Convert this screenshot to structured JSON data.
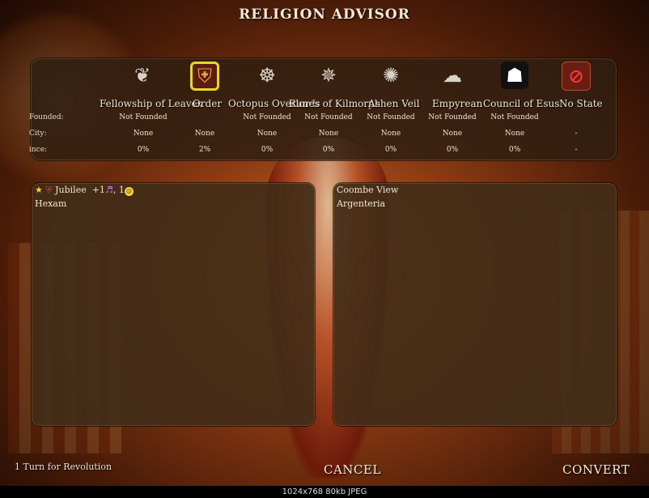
{
  "title": "RELIGION ADVISOR",
  "row_labels": {
    "founded": "Founded:",
    "city": "City:",
    "influence": "ince:"
  },
  "religions": [
    {
      "name": "Fellowship of Leaves",
      "icon": "leaf-icon",
      "founded": "Not Founded",
      "city": "",
      "influence": "0%"
    },
    {
      "name": "Order",
      "icon": "order-shield-icon",
      "founded": "",
      "city": "None",
      "influence": "2%",
      "selected": true
    },
    {
      "name": "Octopus Overlords",
      "icon": "octopus-icon",
      "founded": "Not Founded",
      "city": "None",
      "influence": "0%"
    },
    {
      "name": "Runes of Kilmorph",
      "icon": "rune-compass-icon",
      "founded": "Not Founded",
      "city": "None",
      "influence": "0%"
    },
    {
      "name": "Ashen Veil",
      "icon": "ashen-veil-icon",
      "founded": "Not Founded",
      "city": "None",
      "influence": "0%"
    },
    {
      "name": "Empyrean",
      "icon": "empyrean-wing-icon",
      "founded": "Not Founded",
      "city": "None",
      "influence": "0%"
    },
    {
      "name": "Council of Esus",
      "icon": "esus-hooded-icon",
      "founded": "Not Founded",
      "city": "None",
      "influence": "0%"
    },
    {
      "name": "No State",
      "icon": "no-state-icon",
      "founded": "",
      "city": "-",
      "influence": "-"
    }
  ],
  "extra_city": {
    "col0": "None"
  },
  "left_panel": {
    "line1": {
      "city": "Jubilee",
      "bonus": "+1",
      "happy": "1"
    },
    "line2": "Hexam"
  },
  "right_panel": {
    "line1": "Coombe View",
    "line2": "Argenteria"
  },
  "footer": {
    "revolution": "1 Turn for Revolution",
    "cancel": "CANCEL",
    "convert": "CONVERT"
  },
  "statusbar": "1024x768 80kb JPEG"
}
